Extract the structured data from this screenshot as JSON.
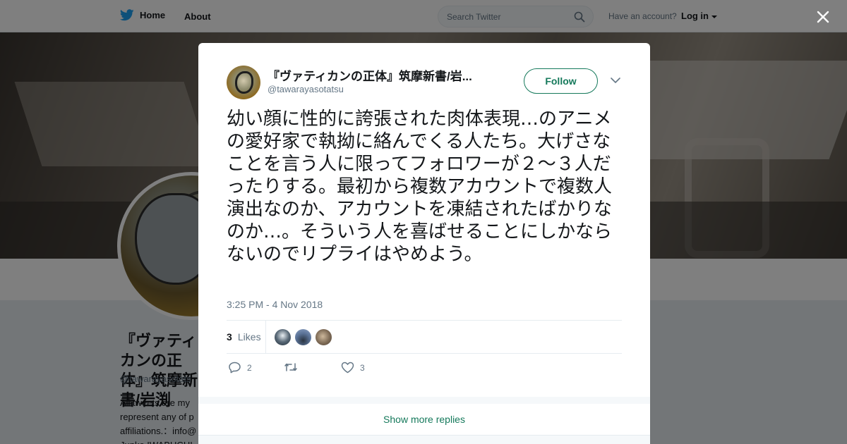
{
  "topbar": {
    "home_label": "Home",
    "about_label": "About",
    "search_placeholder": "Search Twitter",
    "account_text": "Have an account?",
    "login_label": "Log in"
  },
  "profile": {
    "name": "『ヴァティカンの正体』筑摩新書/岩渕",
    "handle": "@tawarayasotats",
    "bio": "All tweets are my represent any of p affiliations.：info@ Junko IWABUCHI"
  },
  "tweet": {
    "author_name": "『ヴァティカンの正体』筑摩新書/岩...",
    "author_handle": "@tawarayasotatsu",
    "follow_label": "Follow",
    "text": "幼い顔に性的に誇張された肉体表現…のアニメの愛好家で執拗に絡んでくる人たち。大げさなことを言う人に限ってフォロワーが２〜３人だったりする。最初から複数アカウントで複数人演出なのか、アカウントを凍結されたばかりなのか…。そういう人を喜ばせることにしかならないのでリプライはやめよう。",
    "timestamp": "3:25 PM - 4 Nov 2018",
    "likes_count": "3",
    "likes_label": "Likes",
    "reply_count": "2",
    "retweet_count": "",
    "like_count": "3"
  },
  "show_more_label": "Show more replies",
  "colors": {
    "accent": "#15795b",
    "twitter_blue": "#1da1f2",
    "muted": "#657786"
  }
}
